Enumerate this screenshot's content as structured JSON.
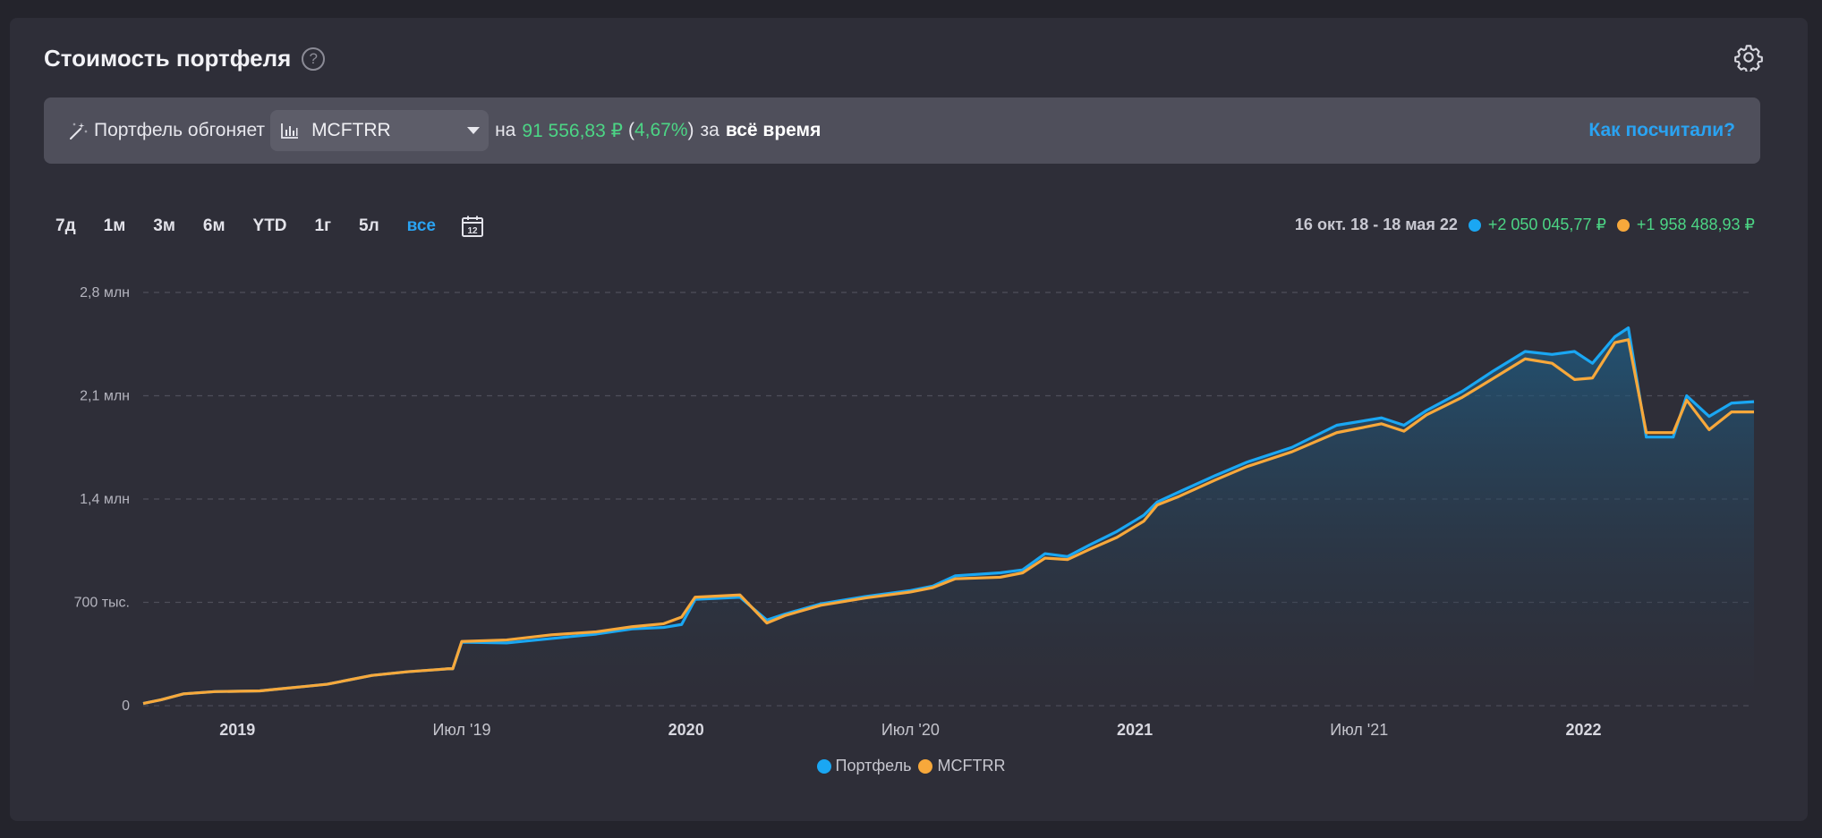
{
  "header": {
    "title": "Стоимость портфеля",
    "help_icon": "?",
    "settings_icon": "gear-icon"
  },
  "banner": {
    "prefix": "Портфель обгоняет",
    "benchmark": "MCFTRR",
    "on": "на",
    "amount": "91 556,83 ₽",
    "paren_open": "(",
    "percent": "4,67%",
    "paren_close": ")",
    "za": "за",
    "period": "всё время",
    "link": "Как посчитали?"
  },
  "tabs": [
    {
      "label": "7д",
      "active": false
    },
    {
      "label": "1м",
      "active": false
    },
    {
      "label": "3м",
      "active": false
    },
    {
      "label": "6м",
      "active": false
    },
    {
      "label": "YTD",
      "active": false
    },
    {
      "label": "1г",
      "active": false
    },
    {
      "label": "5л",
      "active": false
    },
    {
      "label": "все",
      "active": true
    }
  ],
  "summary": {
    "date_range": "16 окт. 18 - 18 мая 22",
    "portfolio_delta": "+2 050 045,77 ₽",
    "benchmark_delta": "+1 958 488,93 ₽"
  },
  "colors": {
    "portfolio": "#1aa7f3",
    "benchmark": "#f7a83b",
    "accent": "#2aa3f2",
    "positive": "#4cd585"
  },
  "legend": {
    "portfolio": "Портфель",
    "benchmark": "MCFTRR"
  },
  "chart_data": {
    "type": "line",
    "y_ticks": [
      "0",
      "700 тыс.",
      "1,4 млн",
      "2,1 млн",
      "2,8 млн"
    ],
    "y_tick_values": [
      0,
      700000,
      1400000,
      2100000,
      2800000
    ],
    "ylim": [
      0,
      2800000
    ],
    "x_ticks": [
      {
        "label": "2019",
        "t": 2019.0,
        "bold": true
      },
      {
        "label": "Июл '19",
        "t": 2019.5,
        "bold": false
      },
      {
        "label": "2020",
        "t": 2020.0,
        "bold": true
      },
      {
        "label": "Июл '20",
        "t": 2020.5,
        "bold": false
      },
      {
        "label": "2021",
        "t": 2021.0,
        "bold": true
      },
      {
        "label": "Июл '21",
        "t": 2021.5,
        "bold": false
      },
      {
        "label": "2022",
        "t": 2022.0,
        "bold": true
      }
    ],
    "xlim": [
      2018.79,
      2022.38
    ],
    "grid": true,
    "area_fill_series": "Портфель",
    "series": [
      {
        "name": "Портфель",
        "color": "#1aa7f3",
        "points": [
          [
            2018.79,
            15000
          ],
          [
            2018.83,
            40000
          ],
          [
            2018.88,
            80000
          ],
          [
            2018.95,
            95000
          ],
          [
            2019.05,
            100000
          ],
          [
            2019.1,
            115000
          ],
          [
            2019.15,
            130000
          ],
          [
            2019.2,
            145000
          ],
          [
            2019.25,
            175000
          ],
          [
            2019.3,
            205000
          ],
          [
            2019.38,
            230000
          ],
          [
            2019.45,
            245000
          ],
          [
            2019.47,
            250000
          ],
          [
            2019.48,
            250000
          ],
          [
            2019.5,
            430000
          ],
          [
            2019.6,
            425000
          ],
          [
            2019.7,
            455000
          ],
          [
            2019.8,
            485000
          ],
          [
            2019.88,
            520000
          ],
          [
            2019.95,
            530000
          ],
          [
            2019.99,
            550000
          ],
          [
            2020.02,
            720000
          ],
          [
            2020.12,
            735000
          ],
          [
            2020.18,
            580000
          ],
          [
            2020.22,
            620000
          ],
          [
            2020.3,
            690000
          ],
          [
            2020.4,
            740000
          ],
          [
            2020.5,
            780000
          ],
          [
            2020.55,
            810000
          ],
          [
            2020.6,
            880000
          ],
          [
            2020.7,
            900000
          ],
          [
            2020.75,
            920000
          ],
          [
            2020.8,
            1030000
          ],
          [
            2020.85,
            1010000
          ],
          [
            2020.9,
            1090000
          ],
          [
            2020.96,
            1180000
          ],
          [
            2021.02,
            1290000
          ],
          [
            2021.05,
            1380000
          ],
          [
            2021.1,
            1450000
          ],
          [
            2021.18,
            1560000
          ],
          [
            2021.25,
            1650000
          ],
          [
            2021.35,
            1750000
          ],
          [
            2021.45,
            1900000
          ],
          [
            2021.55,
            1950000
          ],
          [
            2021.6,
            1900000
          ],
          [
            2021.65,
            2000000
          ],
          [
            2021.73,
            2130000
          ],
          [
            2021.8,
            2270000
          ],
          [
            2021.87,
            2400000
          ],
          [
            2021.93,
            2380000
          ],
          [
            2021.98,
            2400000
          ],
          [
            2022.02,
            2320000
          ],
          [
            2022.07,
            2500000
          ],
          [
            2022.1,
            2560000
          ],
          [
            2022.14,
            1820000
          ],
          [
            2022.2,
            1820000
          ],
          [
            2022.23,
            2100000
          ],
          [
            2022.28,
            1960000
          ],
          [
            2022.33,
            2050000
          ],
          [
            2022.38,
            2060000
          ]
        ]
      },
      {
        "name": "MCFTRR",
        "color": "#f7a83b",
        "points": [
          [
            2018.79,
            15000
          ],
          [
            2018.83,
            40000
          ],
          [
            2018.88,
            80000
          ],
          [
            2018.95,
            95000
          ],
          [
            2019.05,
            100000
          ],
          [
            2019.1,
            115000
          ],
          [
            2019.15,
            130000
          ],
          [
            2019.2,
            145000
          ],
          [
            2019.25,
            175000
          ],
          [
            2019.3,
            205000
          ],
          [
            2019.38,
            230000
          ],
          [
            2019.45,
            245000
          ],
          [
            2019.47,
            250000
          ],
          [
            2019.48,
            250000
          ],
          [
            2019.5,
            435000
          ],
          [
            2019.6,
            445000
          ],
          [
            2019.7,
            480000
          ],
          [
            2019.8,
            500000
          ],
          [
            2019.88,
            535000
          ],
          [
            2019.95,
            555000
          ],
          [
            2019.99,
            600000
          ],
          [
            2020.02,
            735000
          ],
          [
            2020.12,
            750000
          ],
          [
            2020.18,
            560000
          ],
          [
            2020.22,
            610000
          ],
          [
            2020.3,
            680000
          ],
          [
            2020.4,
            730000
          ],
          [
            2020.5,
            770000
          ],
          [
            2020.55,
            800000
          ],
          [
            2020.6,
            860000
          ],
          [
            2020.7,
            870000
          ],
          [
            2020.75,
            900000
          ],
          [
            2020.8,
            1000000
          ],
          [
            2020.85,
            990000
          ],
          [
            2020.9,
            1060000
          ],
          [
            2020.96,
            1140000
          ],
          [
            2021.02,
            1250000
          ],
          [
            2021.05,
            1360000
          ],
          [
            2021.1,
            1420000
          ],
          [
            2021.18,
            1530000
          ],
          [
            2021.25,
            1620000
          ],
          [
            2021.35,
            1720000
          ],
          [
            2021.45,
            1850000
          ],
          [
            2021.55,
            1910000
          ],
          [
            2021.6,
            1860000
          ],
          [
            2021.65,
            1970000
          ],
          [
            2021.73,
            2090000
          ],
          [
            2021.8,
            2220000
          ],
          [
            2021.87,
            2350000
          ],
          [
            2021.93,
            2320000
          ],
          [
            2021.98,
            2210000
          ],
          [
            2022.02,
            2220000
          ],
          [
            2022.07,
            2460000
          ],
          [
            2022.1,
            2480000
          ],
          [
            2022.14,
            1850000
          ],
          [
            2022.2,
            1850000
          ],
          [
            2022.23,
            2070000
          ],
          [
            2022.28,
            1870000
          ],
          [
            2022.33,
            1990000
          ],
          [
            2022.38,
            1990000
          ]
        ]
      }
    ]
  }
}
